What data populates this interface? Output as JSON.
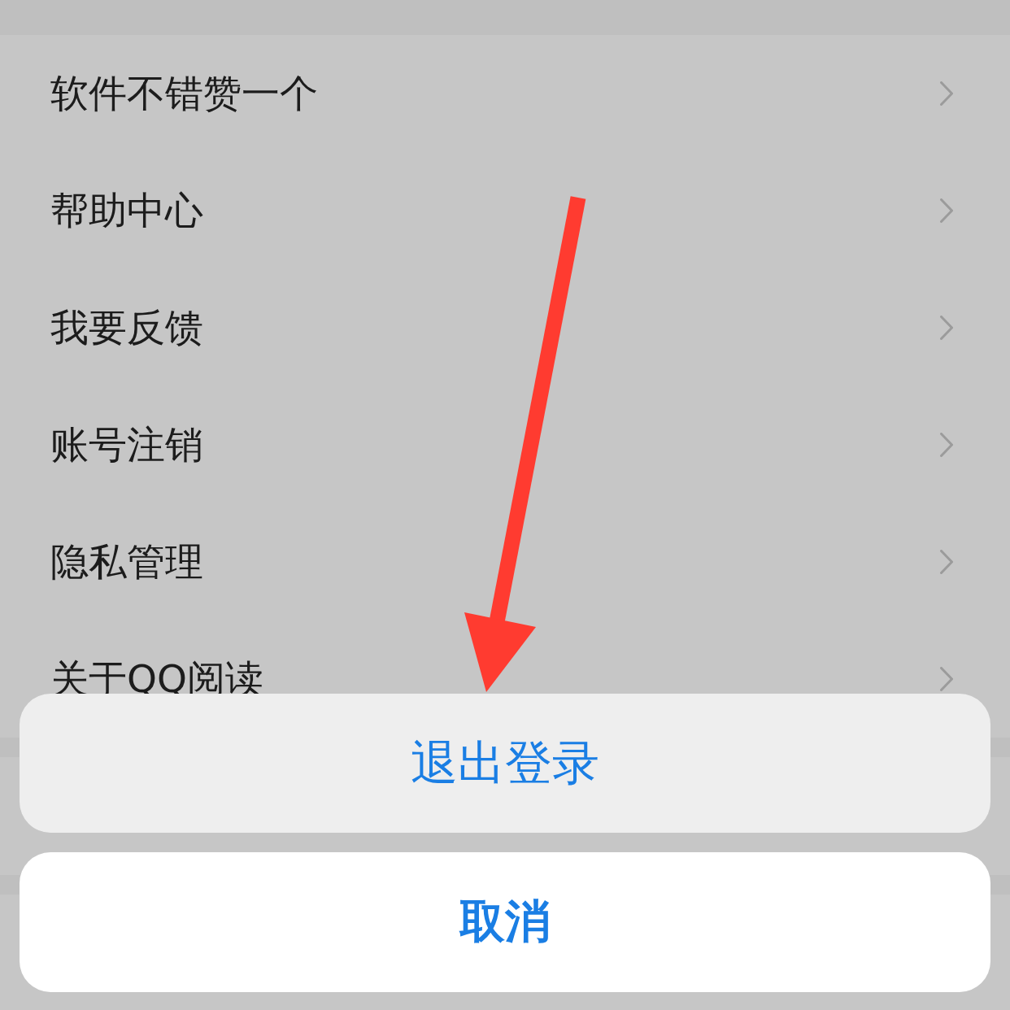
{
  "settings_list": {
    "items": [
      {
        "label": "软件不错赞一个"
      },
      {
        "label": "帮助中心"
      },
      {
        "label": "我要反馈"
      },
      {
        "label": "账号注销"
      },
      {
        "label": "隐私管理"
      },
      {
        "label": "关于QQ阅读"
      }
    ]
  },
  "action_sheet": {
    "actions": [
      {
        "label": "退出登录",
        "kind": "action"
      },
      {
        "label": "取消",
        "kind": "cancel"
      }
    ]
  }
}
